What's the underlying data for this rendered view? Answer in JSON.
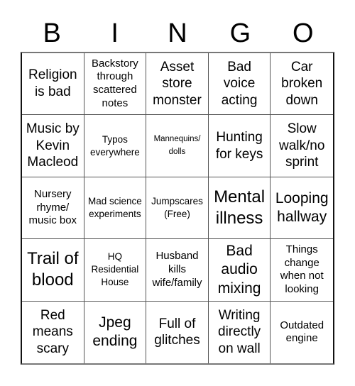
{
  "header": {
    "letters": [
      "B",
      "I",
      "N",
      "G",
      "O"
    ]
  },
  "cells": [
    "Religion is bad",
    "Backstory through scattered notes",
    "Asset store monster",
    "Bad voice acting",
    "Car broken down",
    "Music by Kevin Macleod",
    "Typos everywhere",
    "Mannequins/ dolls",
    "Hunting for keys",
    "Slow walk/no sprint",
    "Nursery rhyme/ music box",
    "Mad science experiments",
    "Jumpscares (Free)",
    "Mental illness",
    "Looping hallway",
    "Trail of blood",
    "HQ Residential House",
    "Husband kills wife/family",
    "Bad audio mixing",
    "Things change when not looking",
    "Red means scary",
    "Jpeg ending",
    "Full of glitches",
    "Writing directly on wall",
    "Outdated engine"
  ]
}
